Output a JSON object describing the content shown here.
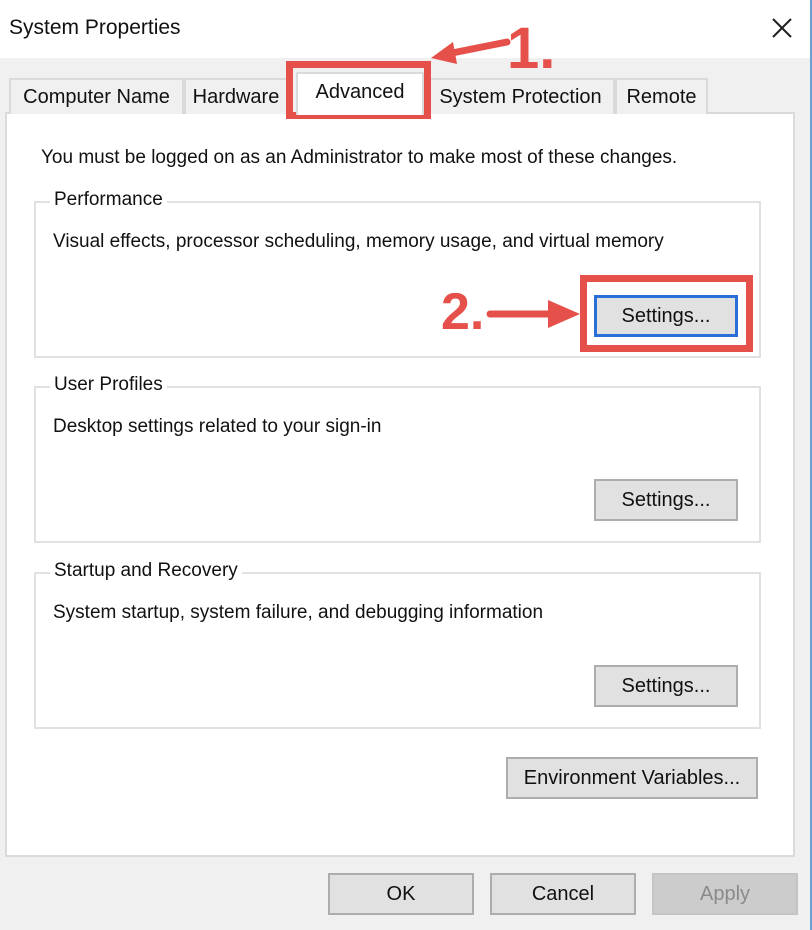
{
  "window": {
    "title": "System Properties",
    "close_icon": "close-x-icon"
  },
  "tabs": [
    {
      "label": "Computer Name",
      "active": false
    },
    {
      "label": "Hardware",
      "active": false
    },
    {
      "label": "Advanced",
      "active": true
    },
    {
      "label": "System Protection",
      "active": false
    },
    {
      "label": "Remote",
      "active": false
    }
  ],
  "advanced": {
    "admin_note": "You must be logged on as an Administrator to make most of these changes.",
    "performance": {
      "legend": "Performance",
      "description": "Visual effects, processor scheduling, memory usage, and virtual memory",
      "button_label": "Settings..."
    },
    "user_profiles": {
      "legend": "User Profiles",
      "description": "Desktop settings related to your sign-in",
      "button_label": "Settings..."
    },
    "startup_recovery": {
      "legend": "Startup and Recovery",
      "description": "System startup, system failure, and debugging information",
      "button_label": "Settings..."
    },
    "env_vars_label": "Environment Variables..."
  },
  "footer": {
    "ok_label": "OK",
    "cancel_label": "Cancel",
    "apply_label": "Apply",
    "apply_enabled": false
  },
  "annotations": {
    "color": "#e5514a",
    "step1_label": "1.",
    "step1_target": "Advanced tab",
    "step2_label": "2.",
    "step2_target": "Performance Settings... button"
  },
  "colors": {
    "focus_border": "#2a6fd6",
    "window_border": "#6aa0d8",
    "dialog_bg": "#f0f0f0",
    "panel_bg": "#ffffff"
  }
}
